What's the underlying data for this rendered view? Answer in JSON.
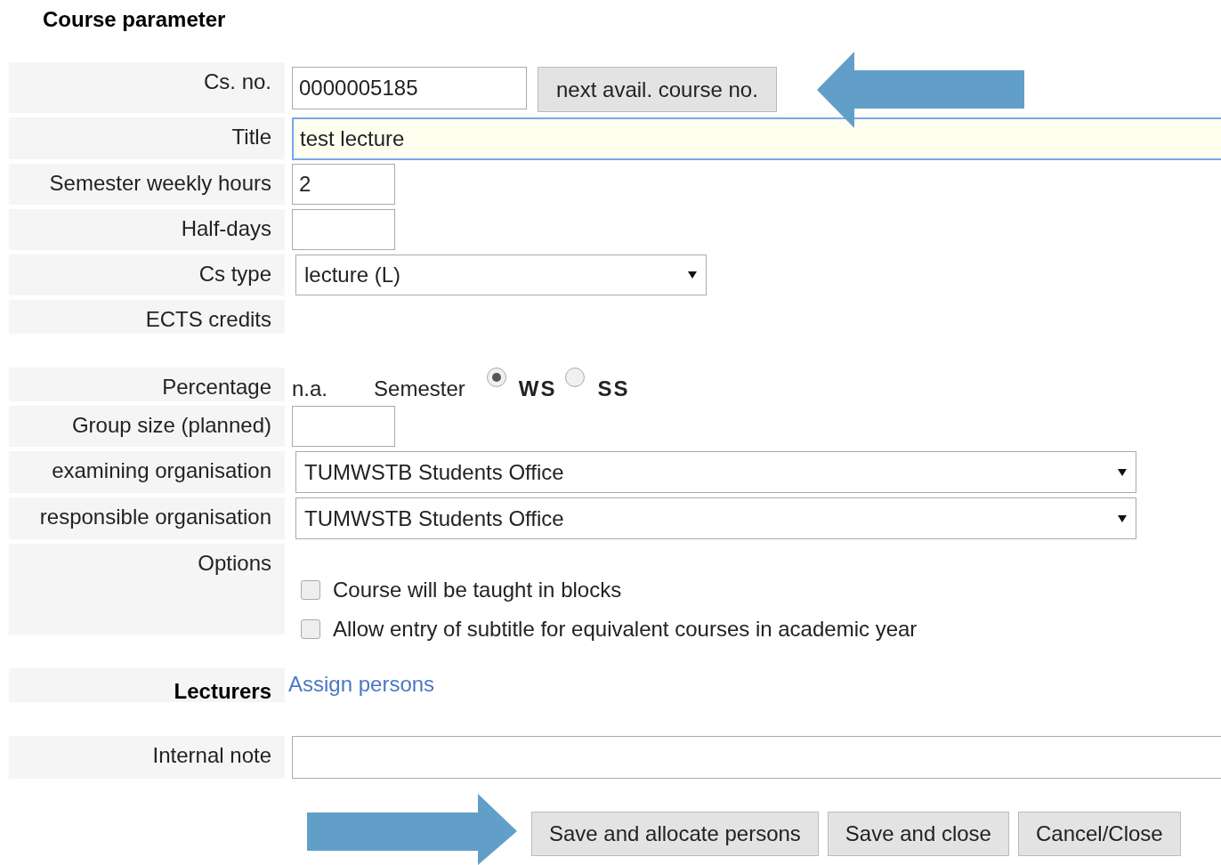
{
  "heading": "Course parameter",
  "sections": [
    [
      {
        "label": "Cs. no.",
        "kind": "code_input",
        "value": "0000005185",
        "button": "next avail. course no."
      },
      {
        "label": "Title",
        "kind": "title_input",
        "value": "test lecture",
        "focused": true
      },
      {
        "label": "Semester weekly hours",
        "kind": "short_input",
        "value": "2"
      },
      {
        "label": "Half-days",
        "kind": "short_input"
      },
      {
        "label": "Cs type",
        "kind": "select",
        "value": "lecture (L)"
      },
      {
        "label": "ECTS credits",
        "kind": "empty"
      }
    ],
    [
      {
        "label": "Percentage",
        "kind": "percentage",
        "value": "n.a.",
        "semester_label": "Semester",
        "radios": [
          {
            "label": "WS",
            "selected": true
          },
          {
            "label": "SS",
            "selected": false
          }
        ]
      },
      {
        "label": "Group size (planned)",
        "kind": "short_input"
      },
      {
        "label": "examining organisation",
        "kind": "wide_select",
        "value": "TUMWSTB Students Office"
      },
      {
        "label": "responsible organisation",
        "kind": "wide_select",
        "value": "TUMWSTB Students Office"
      },
      {
        "label": "Options",
        "kind": "options",
        "options": [
          {
            "label": "Course will be taught in blocks",
            "checked": false
          },
          {
            "label": "Allow entry of subtitle for equivalent courses in academic year",
            "checked": false
          }
        ]
      }
    ],
    [
      {
        "label": "Lecturers",
        "kind": "link",
        "value": "Assign persons"
      }
    ],
    [
      {
        "label": "Internal note",
        "kind": "note"
      }
    ]
  ],
  "buttons": [
    "Save and allocate persons",
    "Save and close",
    "Cancel/Close"
  ]
}
